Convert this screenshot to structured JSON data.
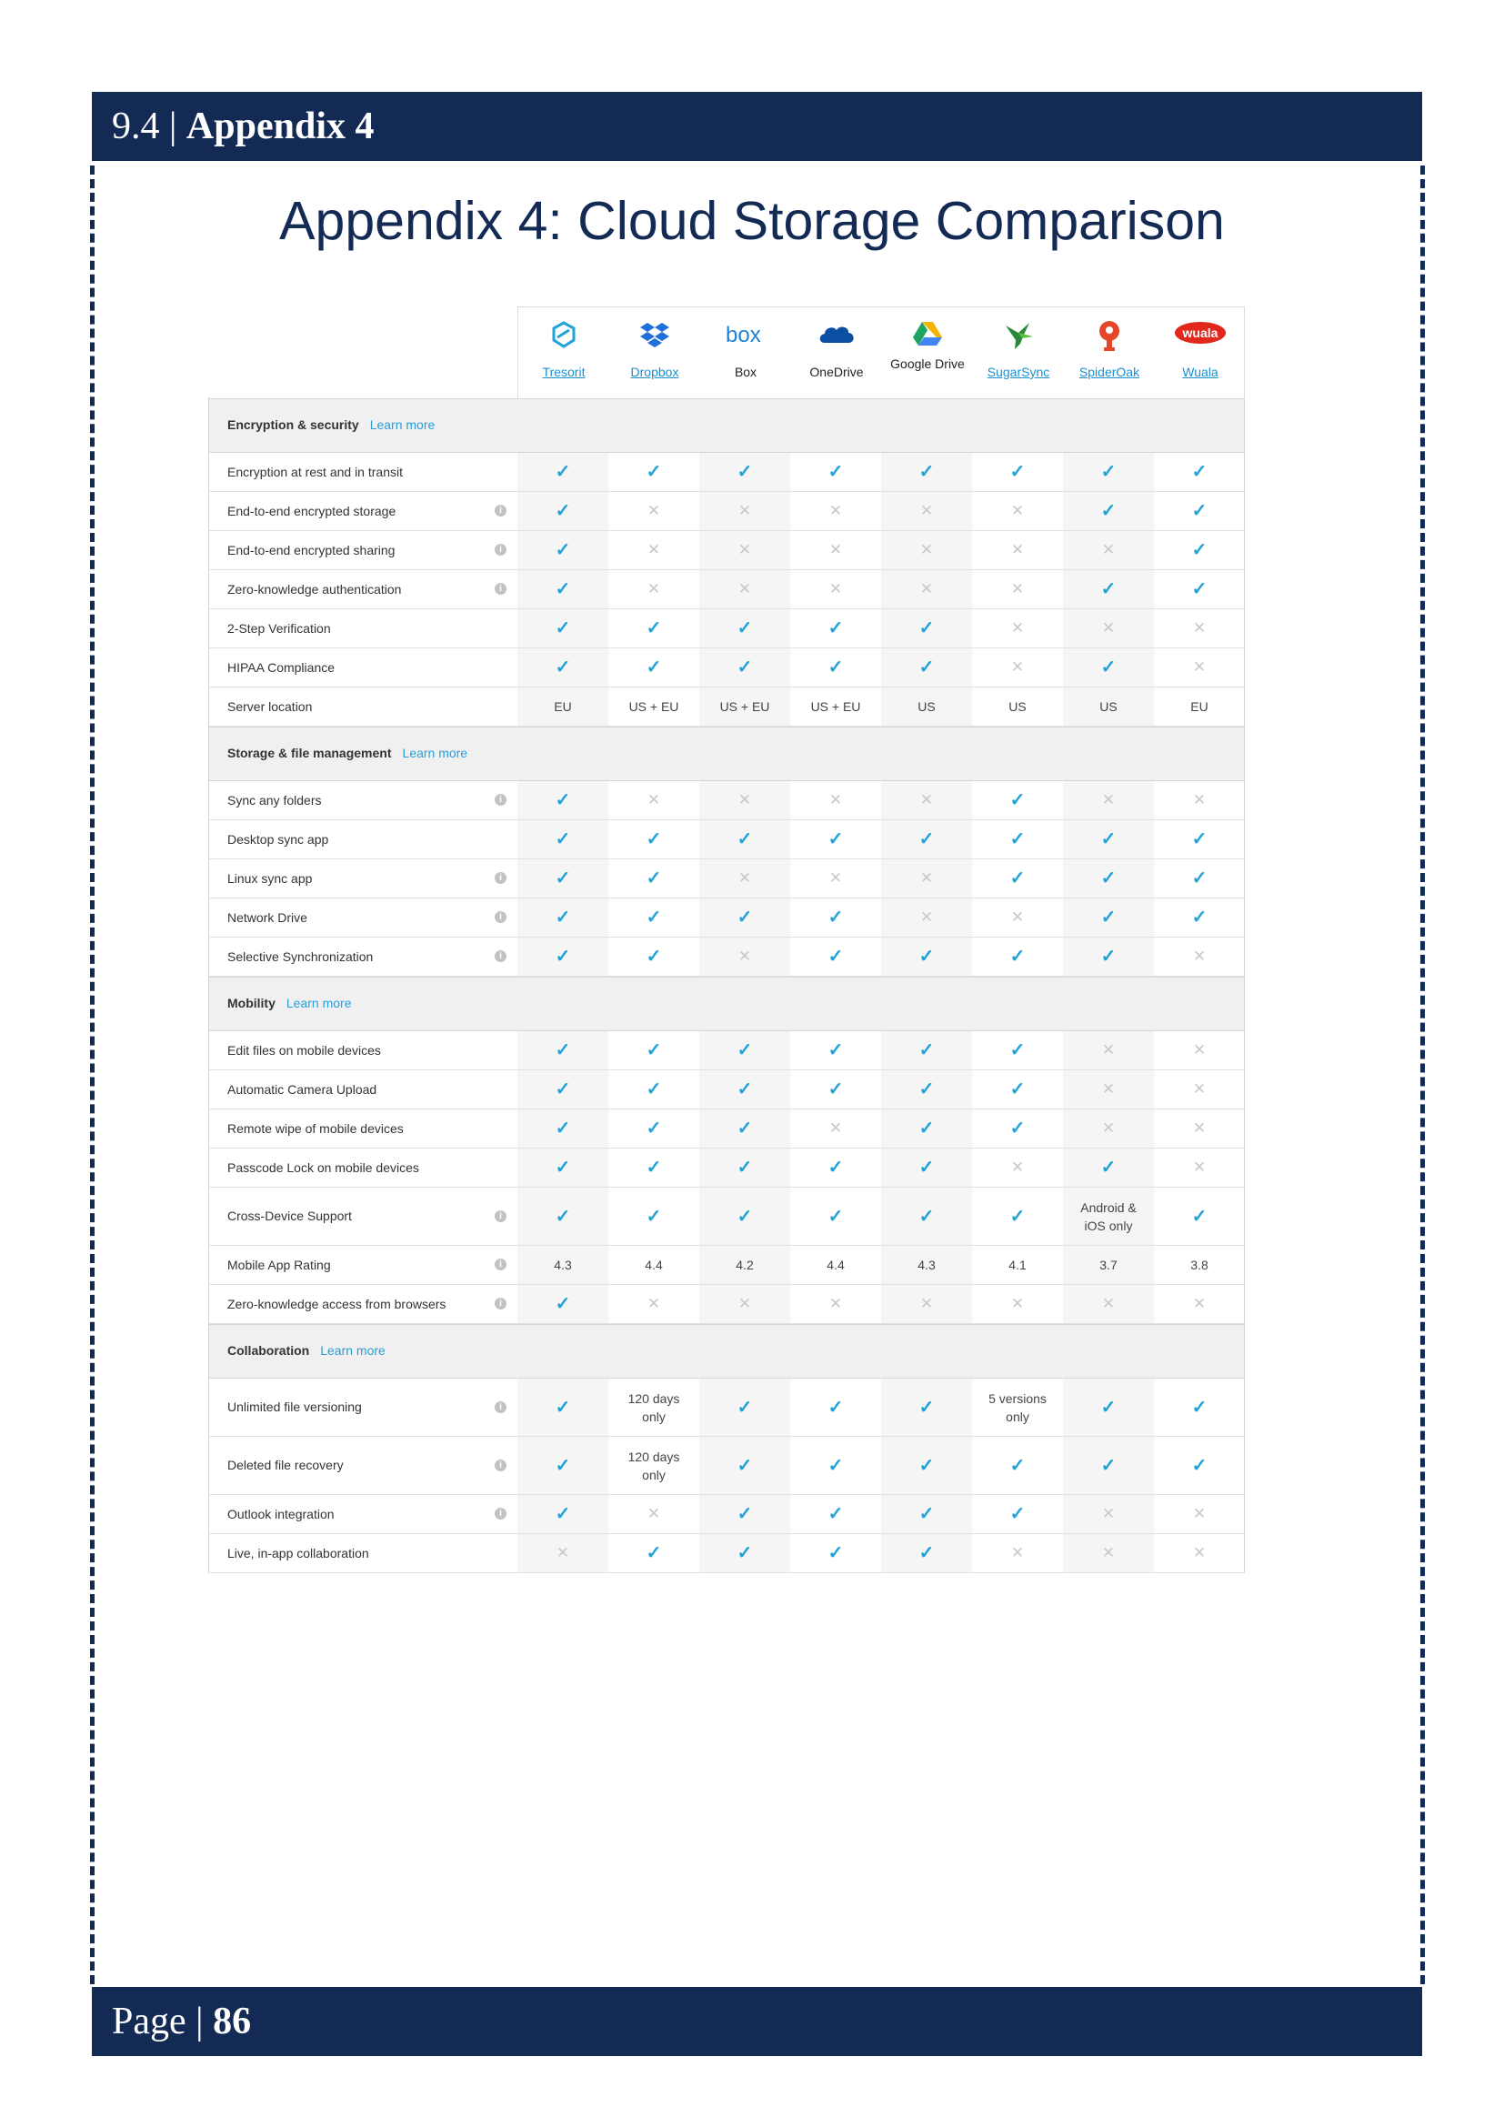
{
  "header": {
    "number": "9.4 |",
    "title": "Appendix 4"
  },
  "page_title": "Appendix 4: Cloud Storage Comparison",
  "footer": {
    "label": "Page |",
    "number": "86"
  },
  "providers": [
    {
      "name": "Tresorit",
      "link": true,
      "icon": "tresorit-logo"
    },
    {
      "name": "Dropbox",
      "link": true,
      "icon": "dropbox-logo"
    },
    {
      "name": "Box",
      "link": false,
      "icon": "box-logo"
    },
    {
      "name": "OneDrive",
      "link": false,
      "icon": "onedrive-logo"
    },
    {
      "name": "Google Drive",
      "link": false,
      "icon": "google-drive-logo"
    },
    {
      "name": "SugarSync",
      "link": true,
      "icon": "sugarsync-logo"
    },
    {
      "name": "SpiderOak",
      "link": true,
      "icon": "spideroak-logo"
    },
    {
      "name": "Wuala",
      "link": true,
      "icon": "wuala-logo",
      "logo_text": "wuala"
    }
  ],
  "sections": [
    {
      "title": "Encryption & security",
      "link": "Learn more",
      "rows": [
        {
          "label": "Encryption at rest and in transit",
          "info": false,
          "values": [
            "Y",
            "Y",
            "Y",
            "Y",
            "Y",
            "Y",
            "Y",
            "Y"
          ]
        },
        {
          "label": "End-to-end encrypted storage",
          "info": true,
          "values": [
            "Y",
            "N",
            "N",
            "N",
            "N",
            "N",
            "Y",
            "Y"
          ]
        },
        {
          "label": "End-to-end encrypted sharing",
          "info": true,
          "values": [
            "Y",
            "N",
            "N",
            "N",
            "N",
            "N",
            "N",
            "Y"
          ]
        },
        {
          "label": "Zero-knowledge authentication",
          "info": true,
          "values": [
            "Y",
            "N",
            "N",
            "N",
            "N",
            "N",
            "Y",
            "Y"
          ]
        },
        {
          "label": "2-Step Verification",
          "info": false,
          "values": [
            "Y",
            "Y",
            "Y",
            "Y",
            "Y",
            "N",
            "N",
            "N"
          ]
        },
        {
          "label": "HIPAA Compliance",
          "info": false,
          "values": [
            "Y",
            "Y",
            "Y",
            "Y",
            "Y",
            "N",
            "Y",
            "N"
          ]
        },
        {
          "label": "Server location",
          "info": false,
          "values": [
            "EU",
            "US + EU",
            "US + EU",
            "US + EU",
            "US",
            "US",
            "US",
            "EU"
          ]
        }
      ]
    },
    {
      "title": "Storage & file management",
      "link": "Learn more",
      "rows": [
        {
          "label": "Sync any folders",
          "info": true,
          "values": [
            "Y",
            "N",
            "N",
            "N",
            "N",
            "Y",
            "N",
            "N"
          ]
        },
        {
          "label": "Desktop sync app",
          "info": false,
          "values": [
            "Y",
            "Y",
            "Y",
            "Y",
            "Y",
            "Y",
            "Y",
            "Y"
          ]
        },
        {
          "label": "Linux sync app",
          "info": true,
          "values": [
            "Y",
            "Y",
            "N",
            "N",
            "N",
            "Y",
            "Y",
            "Y"
          ]
        },
        {
          "label": "Network Drive",
          "info": true,
          "values": [
            "Y",
            "Y",
            "Y",
            "Y",
            "N",
            "N",
            "Y",
            "Y"
          ]
        },
        {
          "label": "Selective Synchronization",
          "info": true,
          "values": [
            "Y",
            "Y",
            "N",
            "Y",
            "Y",
            "Y",
            "Y",
            "N"
          ]
        }
      ]
    },
    {
      "title": "Mobility",
      "link": "Learn more",
      "rows": [
        {
          "label": "Edit files on mobile devices",
          "info": false,
          "values": [
            "Y",
            "Y",
            "Y",
            "Y",
            "Y",
            "Y",
            "N",
            "N"
          ]
        },
        {
          "label": "Automatic Camera Upload",
          "info": false,
          "values": [
            "Y",
            "Y",
            "Y",
            "Y",
            "Y",
            "Y",
            "N",
            "N"
          ]
        },
        {
          "label": "Remote wipe of mobile devices",
          "info": false,
          "values": [
            "Y",
            "Y",
            "Y",
            "N",
            "Y",
            "Y",
            "N",
            "N"
          ]
        },
        {
          "label": "Passcode Lock on mobile devices",
          "info": false,
          "values": [
            "Y",
            "Y",
            "Y",
            "Y",
            "Y",
            "N",
            "Y",
            "N"
          ]
        },
        {
          "label": "Cross-Device Support",
          "info": true,
          "tall": true,
          "values": [
            "Y",
            "Y",
            "Y",
            "Y",
            "Y",
            "Y",
            "Android & iOS only",
            "Y"
          ]
        },
        {
          "label": "Mobile App Rating",
          "info": true,
          "values": [
            "4.3",
            "4.4",
            "4.2",
            "4.4",
            "4.3",
            "4.1",
            "3.7",
            "3.8"
          ]
        },
        {
          "label": "Zero-knowledge access from browsers",
          "info": true,
          "values": [
            "Y",
            "N",
            "N",
            "N",
            "N",
            "N",
            "N",
            "N"
          ]
        }
      ]
    },
    {
      "title": "Collaboration",
      "link": "Learn more",
      "rows": [
        {
          "label": "Unlimited file versioning",
          "info": true,
          "tall": true,
          "values": [
            "Y",
            "120 days only",
            "Y",
            "Y",
            "Y",
            "5 versions only",
            "Y",
            "Y"
          ]
        },
        {
          "label": "Deleted file recovery",
          "info": true,
          "tall": true,
          "values": [
            "Y",
            "120 days only",
            "Y",
            "Y",
            "Y",
            "Y",
            "Y",
            "Y"
          ]
        },
        {
          "label": "Outlook integration",
          "info": true,
          "values": [
            "Y",
            "N",
            "Y",
            "Y",
            "Y",
            "Y",
            "N",
            "N"
          ]
        },
        {
          "label": "Live, in-app collaboration",
          "info": false,
          "values": [
            "N",
            "Y",
            "Y",
            "Y",
            "Y",
            "N",
            "N",
            "N"
          ]
        }
      ]
    }
  ]
}
